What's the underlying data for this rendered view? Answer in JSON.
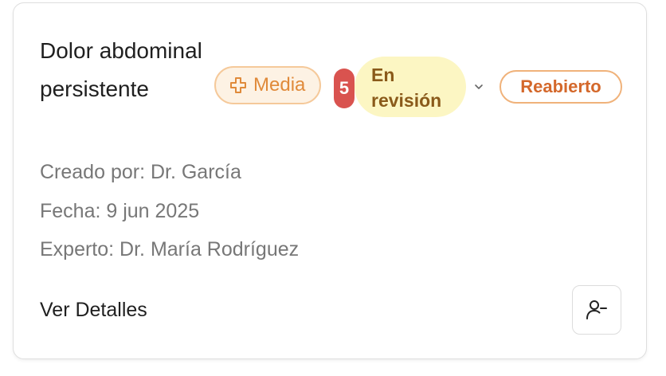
{
  "case": {
    "title": "Dolor abdominal persistente",
    "priority_label": "Media",
    "count": "5",
    "status_line1": "En",
    "status_line2": "revisión",
    "reopened_label": "Reabierto",
    "created_by": "Creado por: Dr. García",
    "date": "Fecha: 9 jun 2025",
    "expert": "Experto: Dr. María Rodríguez",
    "details_label": "Ver Detalles"
  },
  "icons": {
    "priority": "plus-icon",
    "status_dropdown": "chevron-down-icon",
    "assign": "user-minus-icon"
  },
  "colors": {
    "priority_text": "#e08a3a",
    "priority_bg": "#fdf2e4",
    "count_bg": "#d9534f",
    "status_bg": "#fcf6c3",
    "status_text": "#8a5a1a",
    "reopened_text": "#d4682b"
  }
}
